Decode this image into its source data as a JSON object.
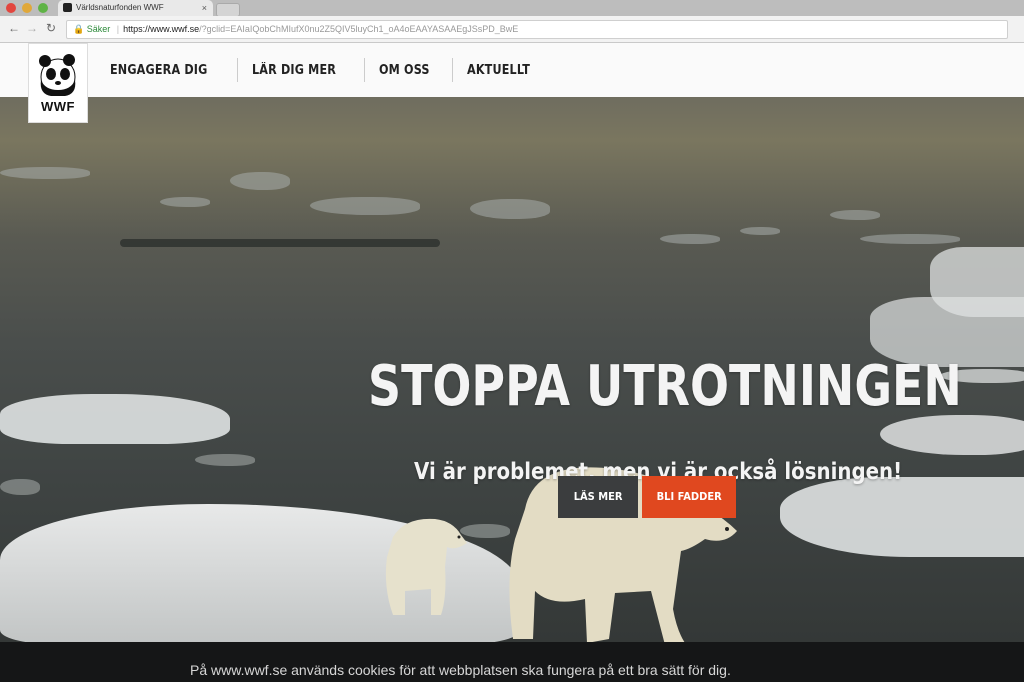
{
  "browser": {
    "tab_title": "Världsnaturfonden WWF",
    "secure_label": "Säker",
    "url_host": "https://www.wwf.se",
    "url_rest": "/?gclid=EAIaIQobChMIufX0nu2Z5QIV5luyCh1_oA4oEAAYASAAEgJSsPD_BwE"
  },
  "site": {
    "logo_text": "WWF",
    "nav": [
      "ENGAGERA DIG",
      "LÄR DIG MER",
      "OM OSS",
      "AKTUELLT"
    ]
  },
  "hero": {
    "title": "STOPPA UTROTNINGEN",
    "subtitle": "Vi är problemet, men vi är också lösningen!",
    "button_read": "LÄS MER",
    "button_adopt": "BLI FADDER"
  },
  "cookie": {
    "text": "På www.wwf.se används cookies för att webbplatsen ska fungera på ett bra sätt för dig."
  },
  "colors": {
    "accent": "#e0481f",
    "button_dark": "#3b3d3e"
  },
  "icons": [
    "close-icon",
    "back-arrow-icon",
    "forward-arrow-icon",
    "reload-icon",
    "lock-icon",
    "panda-logo-icon"
  ]
}
